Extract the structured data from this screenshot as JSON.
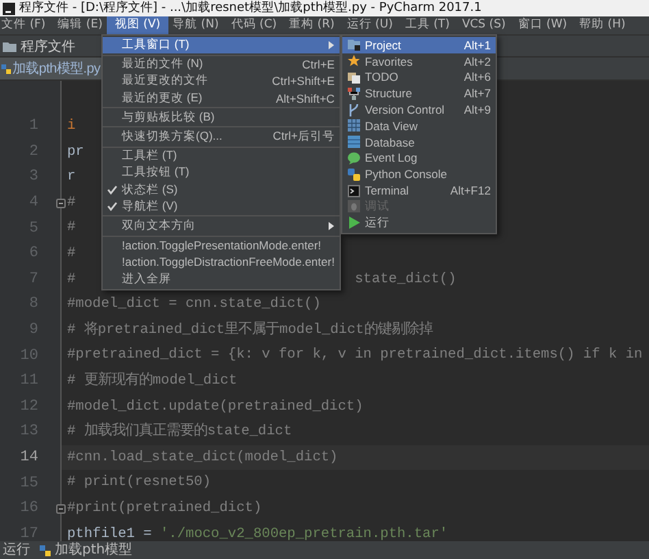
{
  "window": {
    "title": "程序文件 - [D:\\程序文件] - ...\\加载resnet模型\\加载pth模型.py - PyCharm 2017.1"
  },
  "menubar": [
    {
      "label": "文件 (F)",
      "selected": false
    },
    {
      "label": "编辑 (E)",
      "selected": false
    },
    {
      "label": "视图 (V)",
      "selected": true
    },
    {
      "label": "导航 (N)",
      "selected": false
    },
    {
      "label": "代码 (C)",
      "selected": false
    },
    {
      "label": "重构 (R)",
      "selected": false
    },
    {
      "label": "运行 (U)",
      "selected": false
    },
    {
      "label": "工具 (T)",
      "selected": false
    },
    {
      "label": "VCS (S)",
      "selected": false
    },
    {
      "label": "窗口 (W)",
      "selected": false
    },
    {
      "label": "帮助 (H)",
      "selected": false
    }
  ],
  "navbar": {
    "folder": "程序文件"
  },
  "tabs": [
    {
      "label": "加载pth模型.py",
      "selected": true
    }
  ],
  "editor": {
    "lines": [
      {
        "number": "1",
        "kind": "keyword",
        "text": "i",
        "fold": false,
        "current": false
      },
      {
        "number": "2",
        "kind": "code",
        "text": "pr",
        "fold": false,
        "current": false
      },
      {
        "number": "3",
        "kind": "code",
        "text": "r",
        "fold": false,
        "current": false
      },
      {
        "number": "4",
        "kind": "comment",
        "text": "#",
        "fold": true,
        "current": false
      },
      {
        "number": "5",
        "kind": "comment",
        "text": "#",
        "fold": false,
        "current": false
      },
      {
        "number": "6",
        "kind": "comment",
        "text": "#",
        "fold": false,
        "current": false
      },
      {
        "number": "7",
        "kind": "comment",
        "text": "#",
        "tail": "state_dict()",
        "fold": false,
        "current": false
      },
      {
        "number": "8",
        "kind": "comment",
        "text": "#model_dict = cnn.state_dict()",
        "fold": false,
        "current": false
      },
      {
        "number": "9",
        "kind": "comment",
        "text": "# 将pretrained_dict里不属于model_dict的键剔除掉",
        "fold": false,
        "current": false
      },
      {
        "number": "10",
        "kind": "comment",
        "text": "#pretrained_dict = {k: v for k, v in pretrained_dict.items() if k in",
        "fold": false,
        "current": false
      },
      {
        "number": "11",
        "kind": "comment",
        "text": "# 更新现有的model_dict",
        "fold": false,
        "current": false
      },
      {
        "number": "12",
        "kind": "comment",
        "text": "#model_dict.update(pretrained_dict)",
        "fold": false,
        "current": false
      },
      {
        "number": "13",
        "kind": "comment",
        "text": "# 加载我们真正需要的state_dict",
        "fold": false,
        "current": false
      },
      {
        "number": "14",
        "kind": "comment",
        "text": "#cnn.load_state_dict(model_dict)",
        "fold": false,
        "current": true
      },
      {
        "number": "15",
        "kind": "comment",
        "text": "# print(resnet50)",
        "fold": false,
        "current": false
      },
      {
        "number": "16",
        "kind": "comment",
        "text": "#print(pretrained_dict)",
        "fold": true,
        "current": false
      },
      {
        "number": "17",
        "kind": "assign",
        "text": "pthfile1 = ",
        "tail": "'./moco_v2_800ep_pretrain.pth.tar'",
        "fold": false,
        "current": false
      }
    ]
  },
  "view_menu": [
    {
      "kind": "item",
      "label": "工具窗口 (T)",
      "selected": true,
      "checked": false,
      "submenu": true
    },
    {
      "kind": "separator"
    },
    {
      "kind": "item",
      "label": "最近的文件 (N)",
      "shortcut": "Ctrl+E",
      "selected": false,
      "checked": false,
      "submenu": false
    },
    {
      "kind": "item",
      "label": "最近更改的文件",
      "shortcut": "Ctrl+Shift+E",
      "selected": false,
      "checked": false,
      "submenu": false
    },
    {
      "kind": "item",
      "label": "最近的更改 (E)",
      "shortcut": "Alt+Shift+C",
      "selected": false,
      "checked": false,
      "submenu": false
    },
    {
      "kind": "separator"
    },
    {
      "kind": "item",
      "label": "与剪贴板比较 (B)",
      "selected": false,
      "checked": false,
      "submenu": false
    },
    {
      "kind": "separator"
    },
    {
      "kind": "item",
      "label": "快速切换方案(Q)...",
      "shortcut": "Ctrl+后引号",
      "selected": false,
      "checked": false,
      "submenu": false
    },
    {
      "kind": "separator"
    },
    {
      "kind": "item",
      "label": "工具栏 (T)",
      "selected": false,
      "checked": false,
      "submenu": false
    },
    {
      "kind": "item",
      "label": "工具按钮 (T)",
      "selected": false,
      "checked": false,
      "submenu": false
    },
    {
      "kind": "item",
      "label": "状态栏 (S)",
      "selected": false,
      "checked": true,
      "submenu": false
    },
    {
      "kind": "item",
      "label": "导航栏 (V)",
      "selected": false,
      "checked": true,
      "submenu": false
    },
    {
      "kind": "separator"
    },
    {
      "kind": "item",
      "label": "双向文本方向",
      "selected": false,
      "checked": false,
      "submenu": true
    },
    {
      "kind": "separator"
    },
    {
      "kind": "item",
      "label": "!action.TogglePresentationMode.enter!",
      "selected": false,
      "checked": false,
      "submenu": false
    },
    {
      "kind": "item",
      "label": "!action.ToggleDistractionFreeMode.enter!",
      "selected": false,
      "checked": false,
      "submenu": false
    },
    {
      "kind": "item",
      "label": "进入全屏",
      "selected": false,
      "checked": false,
      "submenu": false
    }
  ],
  "tool_windows_menu": [
    {
      "label": "Project",
      "shortcut": "Alt+1",
      "selected": true,
      "disabled": false
    },
    {
      "label": "Favorites",
      "shortcut": "Alt+2",
      "selected": false,
      "disabled": false
    },
    {
      "label": "TODO",
      "shortcut": "Alt+6",
      "selected": false,
      "disabled": false
    },
    {
      "label": "Structure",
      "shortcut": "Alt+7",
      "selected": false,
      "disabled": false
    },
    {
      "label": "Version Control",
      "shortcut": "Alt+9",
      "selected": false,
      "disabled": false
    },
    {
      "label": "Data View",
      "selected": false,
      "disabled": false
    },
    {
      "label": "Database",
      "selected": false,
      "disabled": false
    },
    {
      "label": "Event Log",
      "selected": false,
      "disabled": false
    },
    {
      "label": "Python Console",
      "selected": false,
      "disabled": false
    },
    {
      "label": "Terminal",
      "shortcut": "Alt+F12",
      "selected": false,
      "disabled": false
    },
    {
      "label": "调试",
      "selected": false,
      "disabled": true
    },
    {
      "label": "运行",
      "selected": false,
      "disabled": false
    }
  ],
  "status_bar": {
    "run": "运行",
    "file": "加载pth模型"
  }
}
